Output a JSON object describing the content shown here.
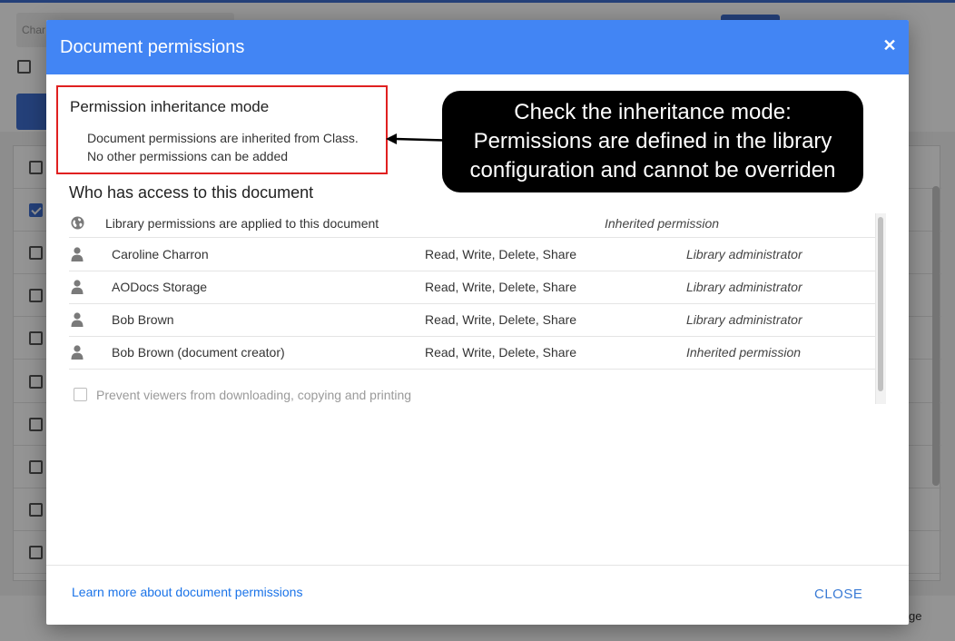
{
  "background": {
    "search_placeholder": "Char",
    "footer_text": "ge",
    "rows": [
      {
        "checked": false
      },
      {
        "checked": true
      },
      {
        "checked": false
      },
      {
        "checked": false
      },
      {
        "checked": false
      },
      {
        "checked": false
      },
      {
        "checked": false
      },
      {
        "checked": false
      },
      {
        "checked": false
      },
      {
        "checked": false
      }
    ]
  },
  "dialog": {
    "title": "Document permissions",
    "close_icon": "close-icon",
    "inheritance": {
      "title": "Permission inheritance mode",
      "line1": "Document permissions are inherited from Class.",
      "line2": "No other permissions can be added"
    },
    "callout": {
      "line1": "Check the inheritance mode:",
      "line2": "Permissions are defined in the library",
      "line3": "configuration and cannot be overriden"
    },
    "access_title": "Who has access to this document",
    "library_row": {
      "icon": "globe-icon",
      "text": "Library permissions are applied to this document",
      "source": "Inherited permission"
    },
    "permissions": [
      {
        "icon": "person-icon",
        "name": "Caroline Charron",
        "rights": "Read, Write, Delete, Share",
        "source": "Library administrator"
      },
      {
        "icon": "person-icon",
        "name": "AODocs Storage",
        "rights": "Read, Write, Delete, Share",
        "source": "Library administrator"
      },
      {
        "icon": "person-icon",
        "name": "Bob Brown",
        "rights": "Read, Write, Delete, Share",
        "source": "Library administrator"
      },
      {
        "icon": "person-icon",
        "name": "Bob Brown (document creator)",
        "rights": "Read, Write, Delete, Share",
        "source": "Inherited permission"
      }
    ],
    "prevent_label": "Prevent viewers from downloading, copying and printing",
    "prevent_checked": false,
    "learn_more": "Learn more about document permissions",
    "close_label": "CLOSE"
  },
  "colors": {
    "header": "#4285f4",
    "highlight_border": "#e02020",
    "callout_bg": "#000000",
    "link": "#1a73e8"
  }
}
